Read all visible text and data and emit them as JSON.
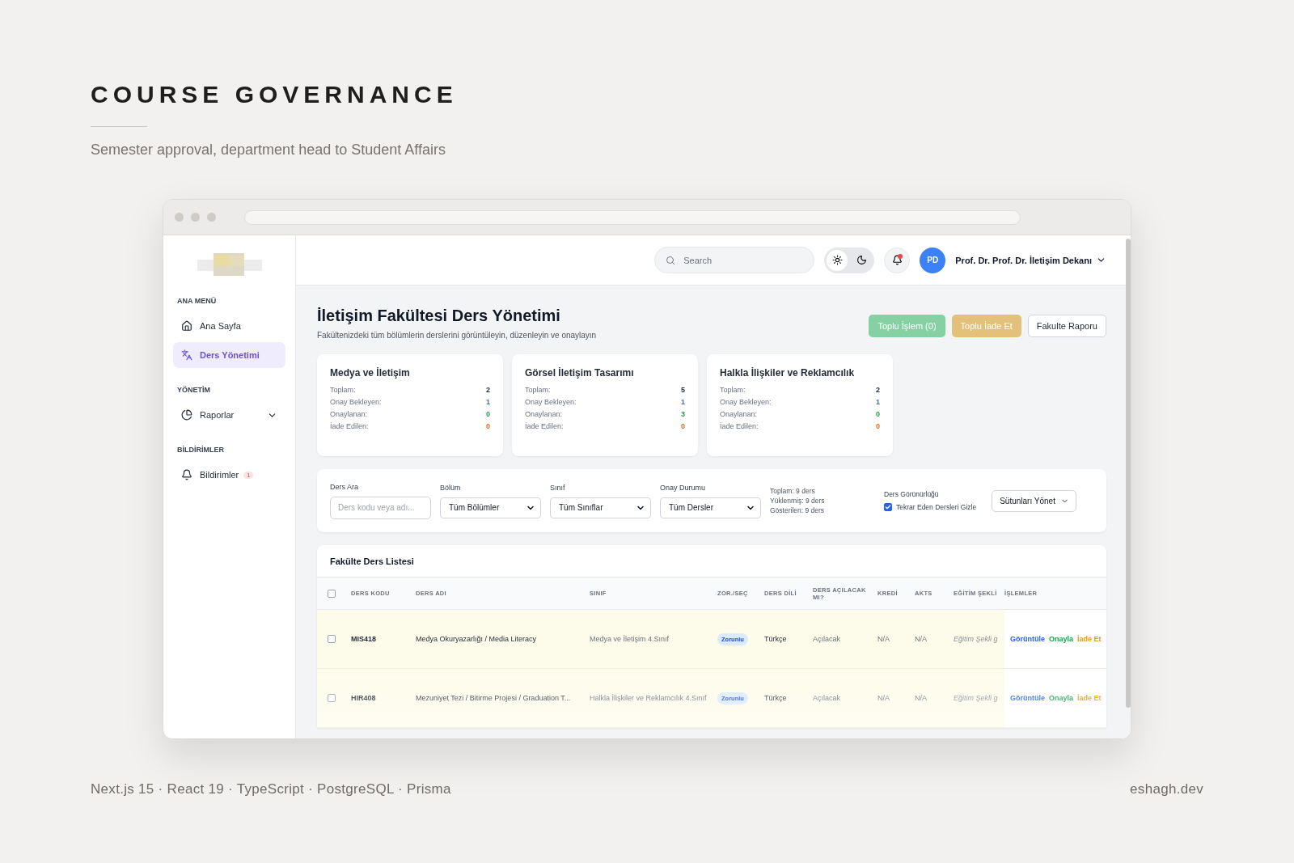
{
  "heading": {
    "title": "COURSE GOVERNANCE",
    "subtitle": "Semester approval, department head to Student Affairs"
  },
  "sidebar": {
    "sections": [
      {
        "label": "ANA MENÜ",
        "items": [
          {
            "label": "Ana Sayfa",
            "selected": false
          },
          {
            "label": "Ders Yönetimi",
            "selected": true
          }
        ]
      },
      {
        "label": "YÖNETİM",
        "items": [
          {
            "label": "Raporlar",
            "selected": false,
            "expanded": false
          }
        ]
      },
      {
        "label": "BİLDİRİMLER",
        "items": [
          {
            "label": "Bildirimler",
            "selected": false,
            "badge": "1"
          }
        ]
      }
    ]
  },
  "topbar": {
    "search": {
      "placeholder": "Search"
    },
    "theme": [
      {
        "selected": true
      },
      {
        "selected": false
      }
    ],
    "notifications": {
      "unread": true
    },
    "user": {
      "initials": "PD",
      "name": "Prof. Dr. Prof. Dr. İletişim Dekanı"
    }
  },
  "page": {
    "title": "İletişim Fakültesi Ders Yönetimi",
    "subtitle": "Fakültenizdeki tüm bölümlerin derslerini görüntüleyin, düzenleyin ve onaylayın",
    "actions": [
      {
        "label": "Toplu İşlem (0)",
        "kind": "success"
      },
      {
        "label": "Toplu İade Et",
        "kind": "warning"
      },
      {
        "label": "Fakulte Raporu",
        "kind": "outline"
      }
    ]
  },
  "departments": [
    {
      "name": "Medya ve İletişim",
      "stats": [
        {
          "label": "Toplam:",
          "value": "2",
          "kind": "total"
        },
        {
          "label": "Onay Bekleyen:",
          "value": "1",
          "kind": "pending"
        },
        {
          "label": "Onaylanan:",
          "value": "0",
          "kind": "approved"
        },
        {
          "label": "İade Edilen:",
          "value": "0",
          "kind": "returned"
        }
      ]
    },
    {
      "name": "Görsel İletişim Tasarımı",
      "stats": [
        {
          "label": "Toplam:",
          "value": "5",
          "kind": "total"
        },
        {
          "label": "Onay Bekleyen:",
          "value": "1",
          "kind": "pending"
        },
        {
          "label": "Onaylanan:",
          "value": "3",
          "kind": "approved"
        },
        {
          "label": "İade Edilen:",
          "value": "0",
          "kind": "returned"
        }
      ]
    },
    {
      "name": "Halkla İlişkiler ve Reklamcılık",
      "stats": [
        {
          "label": "Toplam:",
          "value": "2",
          "kind": "total"
        },
        {
          "label": "Onay Bekleyen:",
          "value": "1",
          "kind": "pending"
        },
        {
          "label": "Onaylanan:",
          "value": "0",
          "kind": "approved"
        },
        {
          "label": "İade Edilen:",
          "value": "0",
          "kind": "returned"
        }
      ]
    }
  ],
  "filters": {
    "search": {
      "label": "Ders Ara",
      "placeholder": "Ders kodu veya adı..."
    },
    "selects": [
      {
        "label": "Bölüm",
        "value": "Tüm Bölümler"
      },
      {
        "label": "Sınıf",
        "value": "Tüm Sınıflar"
      },
      {
        "label": "Onay Durumu",
        "value": "Tüm Dersler"
      }
    ],
    "counts": [
      "Toplam: 9 ders",
      "Yüklenmiş: 9 ders",
      "Gösterilen: 9 ders"
    ],
    "visibility": {
      "label": "Ders Görünürlüğü",
      "option": "Tekrar Eden Dersleri Gizle",
      "checked": true
    },
    "columns_button": "Sütunları Yönet"
  },
  "table": {
    "title": "Fakülte Ders Listesi",
    "all_checked": false,
    "columns": [
      "DERS KODU",
      "DERS ADI",
      "SINIF",
      "ZOR./SEÇ",
      "DERS DİLİ",
      "DERS AÇILACAK MI?",
      "KREDİ",
      "AKTS",
      "EĞİTİM ŞEKLİ",
      "İŞLEMLER"
    ],
    "rows": [
      {
        "checked": false,
        "code": "MIS418",
        "name": "Medya Okuryazarlığı / Media Literacy",
        "class": "Medya ve İletişim 4.Sınıf",
        "type": "Zorunlu",
        "language": "Türkçe",
        "opening": "Açılacak",
        "credit": "N/A",
        "ects": "N/A",
        "mode": "Eğitim Şekli g",
        "actions": [
          {
            "label": "Görüntüle",
            "kind": "view"
          },
          {
            "label": "Onayla",
            "kind": "approve"
          },
          {
            "label": "İade Et",
            "kind": "return"
          }
        ]
      },
      {
        "checked": false,
        "code": "HIR408",
        "name": "Mezuniyet Tezi / Bitirme Projesi / Graduation T...",
        "class": "Halkla İlişkiler ve Reklamcılık 4.Sınıf",
        "type": "Zorunlu",
        "language": "Türkçe",
        "opening": "Açılacak",
        "credit": "N/A",
        "ects": "N/A",
        "mode": "Eğitim Şekli g",
        "actions": [
          {
            "label": "Görüntüle",
            "kind": "view"
          },
          {
            "label": "Onayla",
            "kind": "approve"
          },
          {
            "label": "İade Et",
            "kind": "return"
          }
        ]
      }
    ]
  },
  "footer": {
    "stack": "Next.js 15 · React 19 · TypeScript · PostgreSQL · Prisma",
    "site": "eshagh.dev"
  }
}
